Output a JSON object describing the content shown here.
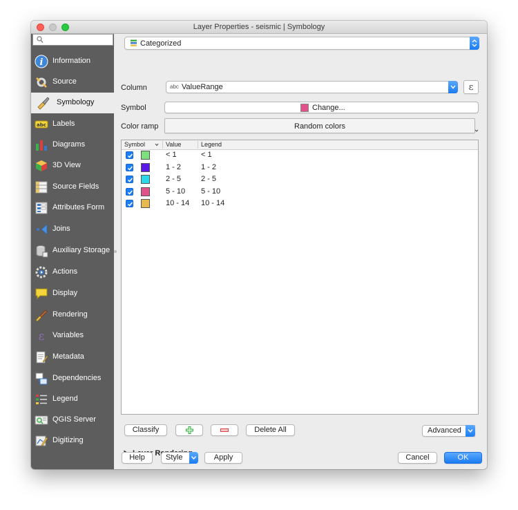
{
  "window": {
    "title": "Layer Properties - seismic | Symbology"
  },
  "sidebar": {
    "search_placeholder": "",
    "items": [
      {
        "label": "Information",
        "icon": "information-icon"
      },
      {
        "label": "Source",
        "icon": "source-icon"
      },
      {
        "label": "Symbology",
        "icon": "symbology-icon"
      },
      {
        "label": "Labels",
        "icon": "labels-icon"
      },
      {
        "label": "Diagrams",
        "icon": "diagrams-icon"
      },
      {
        "label": "3D View",
        "icon": "3d-view-icon"
      },
      {
        "label": "Source Fields",
        "icon": "source-fields-icon"
      },
      {
        "label": "Attributes Form",
        "icon": "attributes-form-icon"
      },
      {
        "label": "Joins",
        "icon": "joins-icon"
      },
      {
        "label": "Auxiliary Storage",
        "icon": "auxiliary-storage-icon"
      },
      {
        "label": "Actions",
        "icon": "actions-icon"
      },
      {
        "label": "Display",
        "icon": "display-icon"
      },
      {
        "label": "Rendering",
        "icon": "rendering-icon"
      },
      {
        "label": "Variables",
        "icon": "variables-icon"
      },
      {
        "label": "Metadata",
        "icon": "metadata-icon"
      },
      {
        "label": "Dependencies",
        "icon": "dependencies-icon"
      },
      {
        "label": "Legend",
        "icon": "legend-icon"
      },
      {
        "label": "QGIS Server",
        "icon": "qgis-server-icon"
      },
      {
        "label": "Digitizing",
        "icon": "digitizing-icon"
      }
    ],
    "active": "Symbology"
  },
  "renderer": {
    "selected": "Categorized"
  },
  "column": {
    "label": "Column",
    "type_badge": "abc",
    "value": "ValueRange",
    "expression_symbol": "ε"
  },
  "symbol": {
    "label": "Symbol",
    "button": "Change...",
    "color": "#e0528a"
  },
  "color_ramp": {
    "label": "Color ramp",
    "value": "Random colors"
  },
  "table": {
    "headers": {
      "symbol": "Symbol",
      "value": "Value",
      "legend": "Legend"
    },
    "rows": [
      {
        "value": "< 1",
        "legend": "< 1",
        "color": "#7ee07e",
        "checked": true
      },
      {
        "value": "1 - 2",
        "legend": "1 - 2",
        "color": "#5a19e6",
        "checked": true
      },
      {
        "value": "2 - 5",
        "legend": "2 - 5",
        "color": "#2ad8e8",
        "checked": true
      },
      {
        "value": "5 - 10",
        "legend": "5 - 10",
        "color": "#e0528a",
        "checked": true
      },
      {
        "value": "10 - 14",
        "legend": "10 - 14",
        "color": "#e8b94e",
        "checked": true
      }
    ]
  },
  "actions": {
    "classify": "Classify",
    "add_icon": "plus-icon",
    "remove_icon": "minus-icon",
    "delete_all": "Delete All",
    "advanced": "Advanced"
  },
  "layer_rendering": {
    "label": "Layer Rendering"
  },
  "footer": {
    "help": "Help",
    "style": "Style",
    "apply": "Apply",
    "cancel": "Cancel",
    "ok": "OK"
  }
}
